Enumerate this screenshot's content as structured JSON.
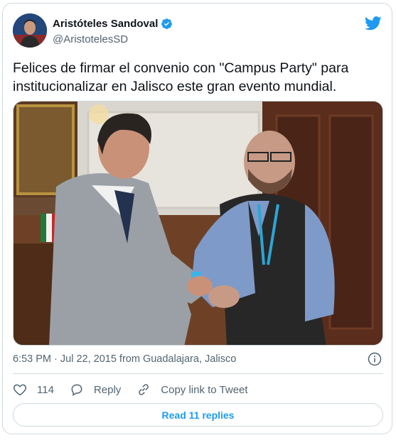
{
  "tweet": {
    "author_name": "Aristóteles Sandoval",
    "author_handle": "@AristotelesSD",
    "text_lines": [
      "Felices de firmar el convenio con \"Campus Party\" para",
      "institucionalizar en Jalisco este gran evento mundial."
    ],
    "timestamp": "6:53 PM · Jul 22, 2015 from Guadalajara, Jalisco",
    "like_count": "114",
    "reply_label": "Reply",
    "copy_link_label": "Copy link to Tweet",
    "read_replies_label": "Read 11 replies"
  },
  "icons": {
    "verified": "verified-badge-icon",
    "logo": "twitter-bird-icon",
    "info": "info-icon",
    "like": "heart-icon",
    "reply": "reply-bubble-icon",
    "link": "link-icon"
  },
  "colors": {
    "accent": "#1d9bf0",
    "secondary_text": "#536471",
    "border": "#cfd9de"
  }
}
